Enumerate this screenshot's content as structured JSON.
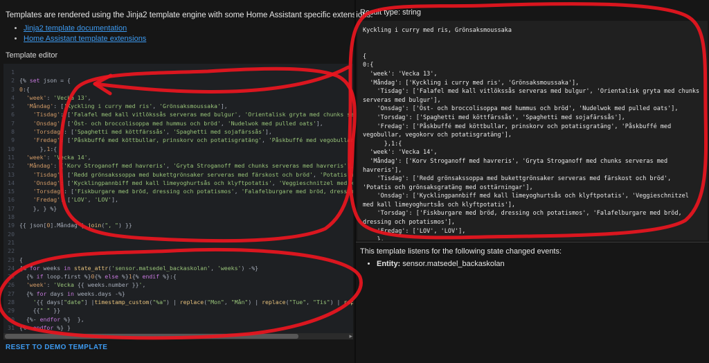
{
  "colors": {
    "annotation": "#ea1620",
    "link": "#3d9af0",
    "string": "#98c379",
    "keyword": "#c678dd",
    "key": "#d19a66"
  },
  "left": {
    "intro": "Templates are rendered using the Jinja2 template engine with some Home Assistant specific extensions.",
    "links": [
      "Jinja2 template documentation",
      "Home Assistant template extensions"
    ],
    "editor_label": "Template editor",
    "reset_label": "RESET TO DEMO TEMPLATE",
    "scroll_arrow": "▸"
  },
  "editor": {
    "lines": [
      {
        "no": 1,
        "segs": []
      },
      {
        "no": 2,
        "segs": [
          [
            "p",
            "{% "
          ],
          [
            "k",
            "set"
          ],
          [
            "p",
            " json = {"
          ]
        ]
      },
      {
        "no": 3,
        "segs": [
          [
            "n",
            "0"
          ],
          [
            "p",
            ":{"
          ]
        ]
      },
      {
        "no": 4,
        "segs": [
          [
            "p",
            "  "
          ],
          [
            "y",
            "'week'"
          ],
          [
            "p",
            ": "
          ],
          [
            "s",
            "'Vecka 13'"
          ],
          [
            "p",
            ","
          ]
        ]
      },
      {
        "no": 5,
        "segs": [
          [
            "p",
            "  "
          ],
          [
            "y",
            "'Måndag'"
          ],
          [
            "p",
            ": ["
          ],
          [
            "s",
            "'Kyckling i curry med ris'"
          ],
          [
            "p",
            ", "
          ],
          [
            "s",
            "'Grönsaksmoussaka'"
          ],
          [
            "p",
            "],"
          ]
        ]
      },
      {
        "no": 6,
        "segs": [
          [
            "p",
            "    "
          ],
          [
            "y",
            "'Tisdag'"
          ],
          [
            "p",
            ": ["
          ],
          [
            "s",
            "'Falafel med kall vitlökssås serveras med bulgur'"
          ],
          [
            "p",
            ", "
          ],
          [
            "s",
            "'Orientalisk gryta med chunks serveras med bulgur'"
          ],
          [
            "p",
            "],"
          ]
        ]
      },
      {
        "no": 7,
        "segs": [
          [
            "p",
            "    "
          ],
          [
            "y",
            "'Onsdag'"
          ],
          [
            "p",
            ": ["
          ],
          [
            "s",
            "'Öst- och broccolisoppa med hummus och bröd'"
          ],
          [
            "p",
            ", "
          ],
          [
            "s",
            "'Nudelwok med pulled oats'"
          ],
          [
            "p",
            "],"
          ]
        ]
      },
      {
        "no": 8,
        "segs": [
          [
            "p",
            "    "
          ],
          [
            "y",
            "'Torsdag'"
          ],
          [
            "p",
            ": ["
          ],
          [
            "s",
            "'Spaghetti med köttfärssås'"
          ],
          [
            "p",
            ", "
          ],
          [
            "s",
            "'Spaghetti med sojafärssås'"
          ],
          [
            "p",
            "],"
          ]
        ]
      },
      {
        "no": 9,
        "segs": [
          [
            "p",
            "    "
          ],
          [
            "y",
            "'Fredag'"
          ],
          [
            "p",
            ": ["
          ],
          [
            "s",
            "'Påskbuffé med köttbullar, prinskorv och potatisgratäng'"
          ],
          [
            "p",
            ", "
          ],
          [
            "s",
            "'Påskbuffé med vegobullar, vegokorv och potatisgratäng'"
          ],
          [
            "p",
            "],"
          ]
        ]
      },
      {
        "no": 10,
        "segs": [
          [
            "p",
            "      },"
          ],
          [
            "n",
            "1"
          ],
          [
            "p",
            ":{"
          ]
        ]
      },
      {
        "no": 11,
        "segs": [
          [
            "p",
            "  "
          ],
          [
            "y",
            "'week'"
          ],
          [
            "p",
            ": "
          ],
          [
            "s",
            "'Vecka 14'"
          ],
          [
            "p",
            ","
          ]
        ]
      },
      {
        "no": 12,
        "segs": [
          [
            "p",
            "  "
          ],
          [
            "y",
            "'Måndag'"
          ],
          [
            "p",
            ": ["
          ],
          [
            "s",
            "'Korv Stroganoff med havreris'"
          ],
          [
            "p",
            ", "
          ],
          [
            "s",
            "'Gryta Stroganoff med chunks serveras med havreris'"
          ],
          [
            "p",
            "],"
          ]
        ]
      },
      {
        "no": 13,
        "segs": [
          [
            "p",
            "    "
          ],
          [
            "y",
            "'Tisdag'"
          ],
          [
            "p",
            ": ["
          ],
          [
            "s",
            "'Redd grönsakssoppa med bukettgrönsaker serveras med färskost och bröd'"
          ],
          [
            "p",
            ", "
          ],
          [
            "s",
            "'Potatis och grönsaksgratäng med osttärningar'"
          ],
          [
            "p",
            "],"
          ]
        ]
      },
      {
        "no": 14,
        "segs": [
          [
            "p",
            "    "
          ],
          [
            "y",
            "'Onsdag'"
          ],
          [
            "p",
            ": ["
          ],
          [
            "s",
            "'Kycklingpannbiff med kall limeyoghurtsås och klyftpotatis'"
          ],
          [
            "p",
            ", "
          ],
          [
            "s",
            "'Veggieschnitzel med kall limeyoghurtsås och klyftpotatis'"
          ],
          [
            "p",
            "],"
          ]
        ]
      },
      {
        "no": 15,
        "segs": [
          [
            "p",
            "    "
          ],
          [
            "y",
            "'Torsdag'"
          ],
          [
            "p",
            ": ["
          ],
          [
            "s",
            "'Fiskburgare med bröd, dressing och potatismos'"
          ],
          [
            "p",
            ", "
          ],
          [
            "s",
            "'Falafelburgare med bröd, dressing och potatismos'"
          ],
          [
            "p",
            "],"
          ]
        ]
      },
      {
        "no": 16,
        "segs": [
          [
            "p",
            "    "
          ],
          [
            "y",
            "'Fredag'"
          ],
          [
            "p",
            ": ["
          ],
          [
            "s",
            "'LOV'"
          ],
          [
            "p",
            ", "
          ],
          [
            "s",
            "'LOV'"
          ],
          [
            "p",
            "],"
          ]
        ]
      },
      {
        "no": 17,
        "segs": [
          [
            "p",
            "    }, } %}"
          ]
        ]
      },
      {
        "no": 18,
        "segs": []
      },
      {
        "no": 19,
        "segs": [
          [
            "p",
            "{{ json["
          ],
          [
            "n",
            "0"
          ],
          [
            "p",
            "].Måndag | "
          ],
          [
            "f",
            "join"
          ],
          [
            "p",
            "("
          ],
          [
            "s",
            "\", \""
          ],
          [
            "p",
            ") }}"
          ]
        ]
      },
      {
        "no": 20,
        "segs": []
      },
      {
        "no": 21,
        "segs": []
      },
      {
        "no": 22,
        "segs": []
      },
      {
        "no": 23,
        "segs": [
          [
            "p",
            "{"
          ]
        ]
      },
      {
        "no": 24,
        "segs": [
          [
            "p",
            "{% "
          ],
          [
            "k",
            "for"
          ],
          [
            "p",
            " weeks "
          ],
          [
            "k",
            "in"
          ],
          [
            "p",
            " "
          ],
          [
            "f",
            "state_attr"
          ],
          [
            "p",
            "("
          ],
          [
            "s",
            "'sensor.matsedel_backaskolan'"
          ],
          [
            "p",
            ", "
          ],
          [
            "s",
            "'weeks'"
          ],
          [
            "p",
            ") -%}"
          ]
        ]
      },
      {
        "no": 25,
        "segs": [
          [
            "p",
            "  {% "
          ],
          [
            "k",
            "if"
          ],
          [
            "p",
            " loop.first %}"
          ],
          [
            "n",
            "0"
          ],
          [
            "p",
            "{% "
          ],
          [
            "k",
            "else"
          ],
          [
            "p",
            " %}"
          ],
          [
            "n",
            "1"
          ],
          [
            "p",
            "{% "
          ],
          [
            "k",
            "endif"
          ],
          [
            "p",
            " %}:{"
          ]
        ]
      },
      {
        "no": 26,
        "segs": [
          [
            "p",
            "  "
          ],
          [
            "y",
            "'week'"
          ],
          [
            "p",
            ": "
          ],
          [
            "s",
            "'Vecka "
          ],
          [
            "p",
            "{{ weeks.number }}"
          ],
          [
            "s",
            "'"
          ],
          [
            "p",
            ","
          ]
        ]
      },
      {
        "no": 27,
        "segs": [
          [
            "p",
            "  {% "
          ],
          [
            "k",
            "for"
          ],
          [
            "p",
            " days "
          ],
          [
            "k",
            "in"
          ],
          [
            "p",
            " weeks.days -%}"
          ]
        ]
      },
      {
        "no": 28,
        "segs": [
          [
            "p",
            "    "
          ],
          [
            "s",
            "'"
          ],
          [
            "p",
            "{{ days["
          ],
          [
            "s",
            "\"date\""
          ],
          [
            "p",
            "] |"
          ],
          [
            "f",
            "timestamp_custom"
          ],
          [
            "p",
            "("
          ],
          [
            "s",
            "\"%a\""
          ],
          [
            "p",
            ") | "
          ],
          [
            "f",
            "replace"
          ],
          [
            "p",
            "("
          ],
          [
            "s",
            "\"Mon\""
          ],
          [
            "p",
            ", "
          ],
          [
            "s",
            "\"Mån\""
          ],
          [
            "p",
            ") | "
          ],
          [
            "f",
            "replace"
          ],
          [
            "p",
            "("
          ],
          [
            "s",
            "\"Tue\""
          ],
          [
            "p",
            ", "
          ],
          [
            "s",
            "\"Tis\""
          ],
          [
            "p",
            ") | "
          ],
          [
            "f",
            "repl"
          ]
        ]
      },
      {
        "no": 29,
        "segs": [
          [
            "p",
            "    {{"
          ],
          [
            "s",
            "\" \""
          ],
          [
            "p",
            " }}"
          ]
        ]
      },
      {
        "no": 30,
        "segs": [
          [
            "p",
            "  {%- "
          ],
          [
            "k",
            "endfor"
          ],
          [
            "p",
            " %}  },"
          ]
        ]
      },
      {
        "no": 31,
        "segs": [
          [
            "p",
            "{%- "
          ],
          [
            "k",
            "endfor"
          ],
          [
            "p",
            " %} }"
          ]
        ]
      }
    ]
  },
  "result": {
    "type_label": "Result type: string",
    "output": "Kyckling i curry med ris, Grönsaksmoussaka\n\n\n{\n0:{\n  'week': 'Vecka 13',\n  'Måndag': ['Kyckling i curry med ris', 'Grönsaksmoussaka'],\n    'Tisdag': ['Falafel med kall vitlökssås serveras med bulgur', 'Orientalisk gryta med chunks serveras med bulgur'],\n    'Onsdag': ['Öst- och broccolisoppa med hummus och bröd', 'Nudelwok med pulled oats'],\n    'Torsdag': ['Spaghetti med köttfärssås', 'Spaghetti med sojafärssås'],\n    'Fredag': ['Påskbuffé med köttbullar, prinskorv och potatisgratäng', 'Påskbuffé med vegobullar, vegokorv och potatisgratäng'],\n      },1:{\n  'week': 'Vecka 14',\n  'Måndag': ['Korv Stroganoff med havreris', 'Gryta Stroganoff med chunks serveras med havreris'],\n    'Tisdag': ['Redd grönsakssoppa med bukettgrönsaker serveras med färskost och bröd', 'Potatis och grönsaksgratäng med osttärningar'],\n    'Onsdag': ['Kycklingpannbiff med kall limeyoghurtsås och klyftpotatis', 'Veggieschnitzel med kall limeyoghurtsås och klyftpotatis'],\n    'Torsdag': ['Fiskburgare med bröd, dressing och potatismos', 'Falafelburgare med bröd, dressing och potatismos'],\n    'Fredag': ['LOV', 'LOV'],\n    },\n }"
  },
  "listens": {
    "text": "This template listens for the following state changed events:",
    "entity_label": "Entity:",
    "entity_value": " sensor.matsedel_backaskolan"
  }
}
